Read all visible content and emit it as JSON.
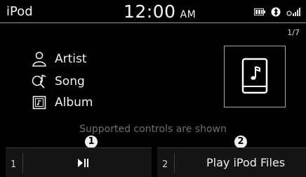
{
  "status_bar": {
    "source": "iPod",
    "time": "12:00",
    "ampm": "AM"
  },
  "page_indicator": "1/7",
  "track_info": {
    "artist": "Artist",
    "song": "Song",
    "album": "Album"
  },
  "supported_text": "Supported controls are shown",
  "controls": {
    "slot1_number": "1",
    "slot2_number": "2",
    "play_files_label": "Play iPod Files"
  },
  "callouts": [
    "1",
    "2"
  ],
  "icons": {
    "artist": "person-icon",
    "song": "music-note-search-icon",
    "album": "album-icon",
    "album_art": "music-device-icon",
    "play_pause": "play-pause-icon",
    "battery": "battery-icon",
    "bluetooth": "bluetooth-icon",
    "signal": "signal-icon"
  }
}
